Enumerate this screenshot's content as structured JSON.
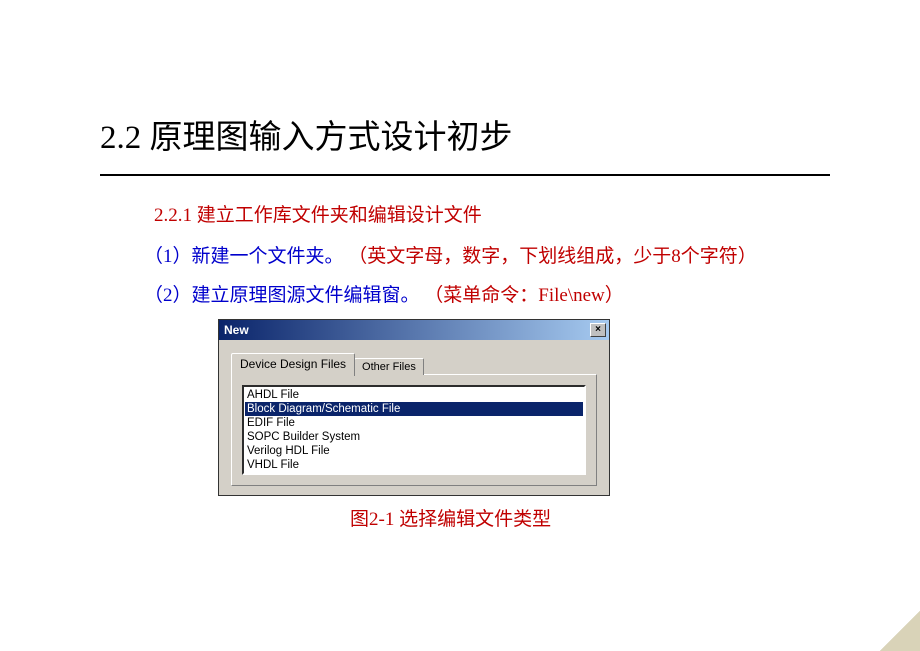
{
  "title": "2.2 原理图输入方式设计初步",
  "subtitle": "2.2.1   建立工作库文件夹和编辑设计文件",
  "p1": {
    "lead": "（1）新建一个文件夹。",
    "note": "（英文字母，数字，下划线组成，少于8个字符）"
  },
  "p2": {
    "lead": "（2）建立原理图源文件编辑窗。",
    "note": "（菜单命令：File\\new）"
  },
  "dialog": {
    "title": "New",
    "close": "×",
    "tabs": {
      "active": "Device Design Files",
      "other": "Other Files"
    },
    "items": [
      "AHDL File",
      "Block Diagram/Schematic File",
      "EDIF File",
      "SOPC Builder System",
      "Verilog HDL File",
      "VHDL File"
    ],
    "selected_index": 1
  },
  "caption": "图2-1 选择编辑文件类型"
}
